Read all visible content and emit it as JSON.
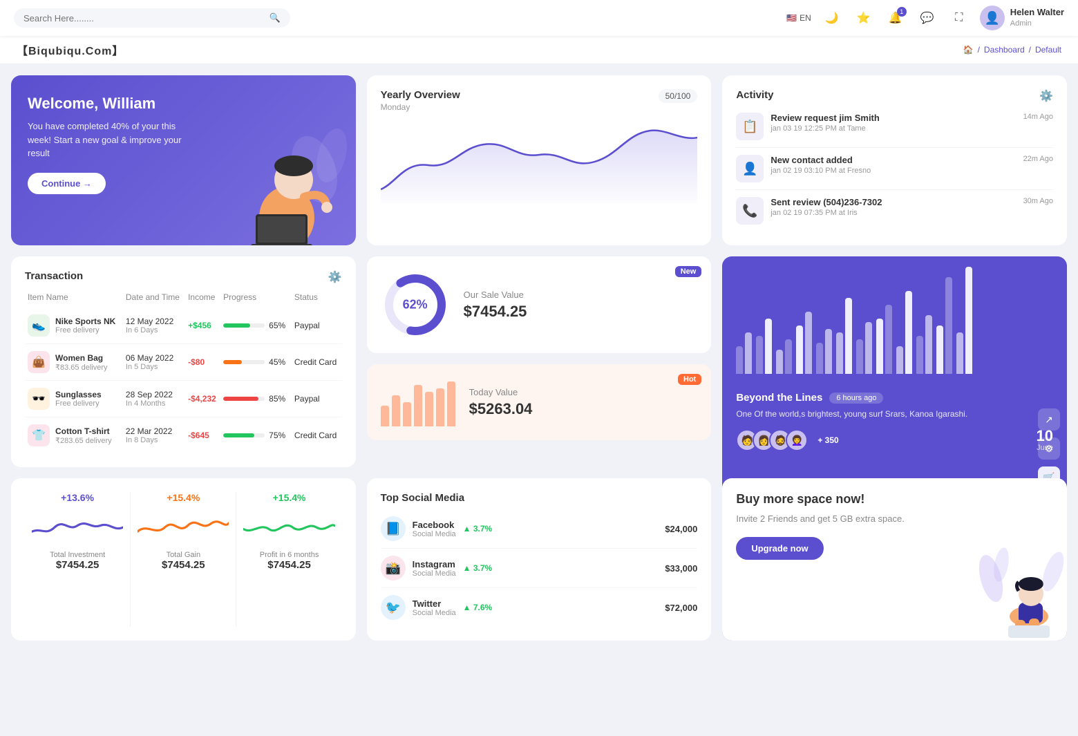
{
  "topnav": {
    "search_placeholder": "Search Here........",
    "language": "EN",
    "user_name": "Helen Walter",
    "user_role": "Admin",
    "notification_count": "1"
  },
  "breadcrumb": {
    "brand": "【Biqubiqu.Com】",
    "home": "🏠",
    "dashboard": "Dashboard",
    "current": "Default"
  },
  "welcome": {
    "title": "Welcome, William",
    "subtitle": "You have completed 40% of your this week! Start a new goal & improve your result",
    "button": "Continue →"
  },
  "yearly": {
    "title": "Yearly Overview",
    "day": "Monday",
    "progress": "50/100"
  },
  "activity": {
    "title": "Activity",
    "items": [
      {
        "title": "Review request jim Smith",
        "sub": "jan 03 19 12:25 PM at Tame",
        "time": "14m Ago",
        "emoji": "📋"
      },
      {
        "title": "New contact added",
        "sub": "jan 02 19 03:10 PM at Fresno",
        "time": "22m Ago",
        "emoji": "👤"
      },
      {
        "title": "Sent review (504)236-7302",
        "sub": "jan 02 19 07:35 PM at Iris",
        "time": "30m Ago",
        "emoji": "📞"
      }
    ]
  },
  "transaction": {
    "title": "Transaction",
    "columns": [
      "Item Name",
      "Date and Time",
      "Income",
      "Progress",
      "Status"
    ],
    "rows": [
      {
        "name": "Nike Sports NK",
        "delivery": "Free delivery",
        "date": "12 May 2022",
        "days": "In 6 Days",
        "income": "+$456",
        "income_type": "positive",
        "progress": 65,
        "progress_color": "#22c55e",
        "status": "Paypal",
        "emoji": "👟",
        "bg": "#e8f5e9"
      },
      {
        "name": "Women Bag",
        "delivery": "₹83.65 delivery",
        "date": "06 May 2022",
        "days": "In 5 Days",
        "income": "-$80",
        "income_type": "negative",
        "progress": 45,
        "progress_color": "#f97316",
        "status": "Credit Card",
        "emoji": "👜",
        "bg": "#fce4ec"
      },
      {
        "name": "Sunglasses",
        "delivery": "Free delivery",
        "date": "28 Sep 2022",
        "days": "In 4 Months",
        "income": "-$4,232",
        "income_type": "negative",
        "progress": 85,
        "progress_color": "#ef4444",
        "status": "Paypal",
        "emoji": "🕶️",
        "bg": "#fff3e0"
      },
      {
        "name": "Cotton T-shirt",
        "delivery": "₹283.65 delivery",
        "date": "22 Mar 2022",
        "days": "In 8 Days",
        "income": "-$645",
        "income_type": "negative",
        "progress": 75,
        "progress_color": "#22c55e",
        "status": "Credit Card",
        "emoji": "👕",
        "bg": "#fce4ec"
      }
    ]
  },
  "sale_value": {
    "label": "Our Sale Value",
    "value": "$7454.25",
    "percent": "62%",
    "badge": "New"
  },
  "today_value": {
    "label": "Today Value",
    "value": "$5263.04",
    "badge": "Hot"
  },
  "bar_chart": {
    "beyond_title": "Beyond the Lines",
    "time_ago": "6 hours ago",
    "desc": "One Of the world,s brightest, young surf Srars, Kanoa Igarashi.",
    "plus_count": "+ 350",
    "date": "10",
    "month": "June",
    "avatars": [
      "🧑",
      "👩",
      "🧔",
      "👩‍🦱"
    ]
  },
  "stats": [
    {
      "pct": "+13.6%",
      "color": "purple",
      "label": "Total Investment",
      "value": "$7454.25"
    },
    {
      "pct": "+15.4%",
      "color": "orange",
      "label": "Total Gain",
      "value": "$7454.25"
    },
    {
      "pct": "+15.4%",
      "color": "green",
      "label": "Profit in 6 months",
      "value": "$7454.25"
    }
  ],
  "social": {
    "title": "Top Social Media",
    "items": [
      {
        "name": "Facebook",
        "type": "Social Media",
        "growth": "3.7%",
        "amount": "$24,000",
        "emoji": "📘",
        "bg": "#e3f2fd"
      },
      {
        "name": "Instagram",
        "type": "Social Media",
        "growth": "3.7%",
        "amount": "$33,000",
        "emoji": "📸",
        "bg": "#fce4ec"
      },
      {
        "name": "Twitter",
        "type": "Social Media",
        "growth": "7.6%",
        "amount": "$72,000",
        "emoji": "🐦",
        "bg": "#e3f2fd"
      }
    ]
  },
  "upgrade": {
    "title": "Buy more space now!",
    "desc": "Invite 2 Friends and get 5 GB extra space.",
    "button": "Upgrade now"
  }
}
